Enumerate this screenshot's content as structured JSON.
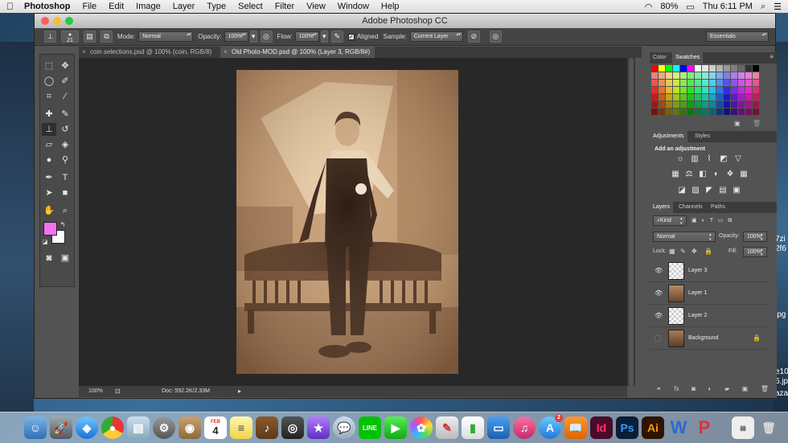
{
  "menubar": {
    "app": "Photoshop",
    "items": [
      "File",
      "Edit",
      "Image",
      "Layer",
      "Type",
      "Select",
      "Filter",
      "View",
      "Window",
      "Help"
    ],
    "battery": "80%",
    "clock": "Thu 6:11 PM"
  },
  "window": {
    "title": "Adobe Photoshop CC"
  },
  "options": {
    "brush_size": "21",
    "mode_label": "Mode:",
    "mode_value": "Normal",
    "opacity_label": "Opacity:",
    "opacity_value": "100%",
    "flow_label": "Flow:",
    "flow_value": "100%",
    "aligned_label": "Aligned",
    "sample_label": "Sample:",
    "sample_value": "Current Layer",
    "workspace": "Essentials"
  },
  "tabs": [
    {
      "label": "coin selections.psd @ 100% (coin, RGB/8)"
    },
    {
      "label": "Old Photo-MOD.psd @ 100% (Layer 3, RGB/8#)"
    }
  ],
  "status": {
    "zoom": "100%",
    "doc": "Doc: 592.2K/2.33M"
  },
  "colors": {
    "foreground": "#f372f0",
    "background": "#ffffff",
    "selected_layer": "#637691"
  },
  "panels": {
    "color_tabs": [
      "Color",
      "Swatches"
    ],
    "adjust_tabs": [
      "Adjustments",
      "Styles"
    ],
    "adjust_hint": "Add an adjustment",
    "layer_tabs": [
      "Layers",
      "Channels",
      "Paths"
    ],
    "kind_label": "Kind",
    "blend_mode": "Normal",
    "opacity_label": "Opacity:",
    "opacity_value": "100%",
    "lock_label": "Lock:",
    "fill_label": "Fill:",
    "fill_value": "100%"
  },
  "layers": [
    {
      "name": "Layer 3",
      "visible": true,
      "selected": true
    },
    {
      "name": "Layer 1",
      "visible": true,
      "selected": false
    },
    {
      "name": "Layer 2",
      "visible": true,
      "selected": false
    },
    {
      "name": "Background",
      "visible": false,
      "selected": false
    }
  ],
  "desktop_right_text": [
    "7zi",
    "2f6",
    "jpg",
    "e10",
    "6.jp",
    "aza"
  ],
  "dock": {
    "calendar_month": "FEB",
    "calendar_day": "4",
    "badge_count": "2"
  }
}
